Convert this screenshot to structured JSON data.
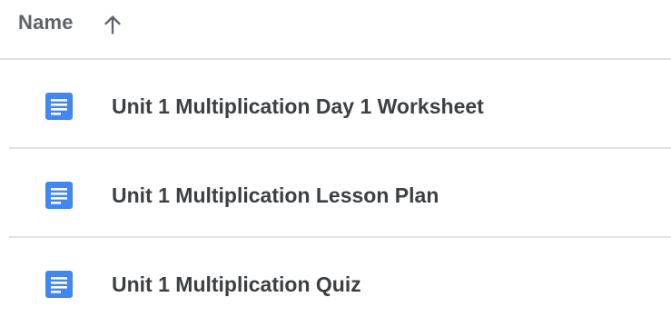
{
  "header": {
    "column_label": "Name",
    "sort_icon": "arrow-up-icon"
  },
  "files": [
    {
      "name": "Unit 1 Multiplication Day 1 Worksheet",
      "icon": "google-docs-icon"
    },
    {
      "name": "Unit 1 Multiplication Lesson Plan",
      "icon": "google-docs-icon"
    },
    {
      "name": "Unit 1 Multiplication Quiz",
      "icon": "google-docs-icon"
    }
  ],
  "colors": {
    "doc_icon": "#4285f4",
    "divider": "#e0e0e0",
    "header_text": "#5f6368",
    "row_text": "#3c4043"
  }
}
